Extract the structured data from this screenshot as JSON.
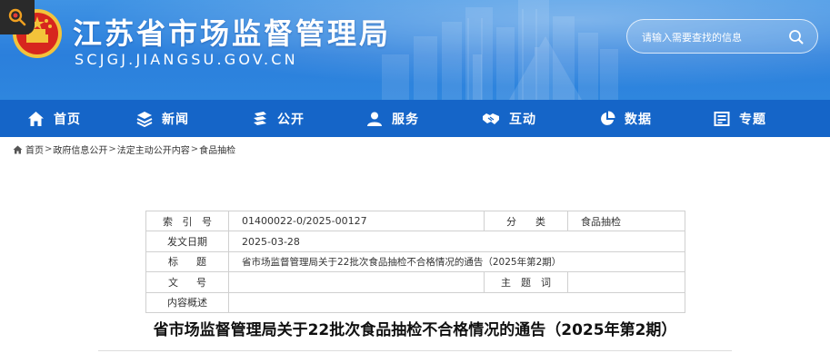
{
  "header": {
    "title": "江苏省市场监督管理局",
    "domain": "SCJGJ.JIANGSU.GOV.CN",
    "search_placeholder": "请输入需要查找的信息"
  },
  "nav": {
    "items": [
      {
        "label": "首页",
        "icon": "home-icon"
      },
      {
        "label": "新闻",
        "icon": "layers-icon"
      },
      {
        "label": "公开",
        "icon": "stack-icon"
      },
      {
        "label": "服务",
        "icon": "user-icon"
      },
      {
        "label": "互动",
        "icon": "handshake-icon"
      },
      {
        "label": "数据",
        "icon": "pie-chart-icon"
      },
      {
        "label": "专题",
        "icon": "grid-icon"
      }
    ]
  },
  "breadcrumb": {
    "items": [
      "首页",
      "政府信息公开",
      "法定主动公开内容",
      "食品抽检"
    ],
    "separator": ">"
  },
  "info": {
    "index_label": [
      "索",
      "引",
      "号"
    ],
    "index_value": "01400022-0/2025-00127",
    "category_label": [
      "分",
      "类"
    ],
    "category_value": "食品抽检",
    "date_label": "发文日期",
    "date_value": "2025-03-28",
    "title_label": [
      "标",
      "题"
    ],
    "title_value": "省市场监督管理局关于22批次食品抽检不合格情况的通告（2025年第2期）",
    "docno_label": [
      "文",
      "号"
    ],
    "docno_value": "",
    "subject_label": [
      "主",
      "题",
      "词"
    ],
    "subject_value": "",
    "summary_label": "内容概述",
    "summary_value": ""
  },
  "document": {
    "title": "省市场监督管理局关于22批次食品抽检不合格情况的通告（2025年第2期）"
  },
  "colors": {
    "banner": "#2b7fdc",
    "nav": "#1565c8",
    "emblem_red": "#d7261e",
    "emblem_gold": "#f3c33a"
  }
}
